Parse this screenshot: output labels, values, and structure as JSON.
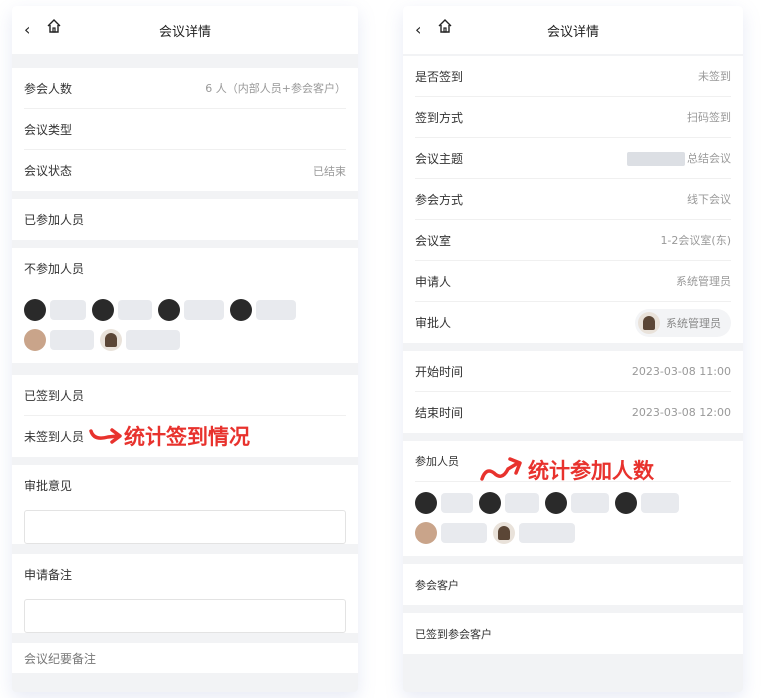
{
  "left": {
    "nav": {
      "title": "会议详情"
    },
    "info_rows": [
      {
        "label": "参会人数",
        "value": "6 人（内部人员+参会客户）"
      },
      {
        "label": "会议类型",
        "value": ""
      },
      {
        "label": "会议状态",
        "value": "已结束"
      }
    ],
    "joined_label": "已参加人员",
    "not_joined_label": "不参加人员",
    "signed_label": "已签到人员",
    "unsigned_label": "未签到人员",
    "review_label": "审批意见",
    "remark_label": "申请备注",
    "bottom_cut_label": "会议纪要备注",
    "annotation": "统计签到情况"
  },
  "right": {
    "nav": {
      "title": "会议详情"
    },
    "rows_a": [
      {
        "label": "是否签到",
        "value": "未签到"
      },
      {
        "label": "签到方式",
        "value": "扫码签到"
      },
      {
        "label": "会议主题",
        "value": "总结会议"
      },
      {
        "label": "参会方式",
        "value": "线下会议"
      },
      {
        "label": "会议室",
        "value": "1-2会议室(东)"
      },
      {
        "label": "申请人",
        "value": "系统管理员"
      }
    ],
    "approver": {
      "label": "审批人",
      "name": "系统管理员"
    },
    "times": [
      {
        "label": "开始时间",
        "value": "2023-03-08 11:00"
      },
      {
        "label": "结束时间",
        "value": "2023-03-08 12:00"
      }
    ],
    "participants_label": "参加人员",
    "clients_label": "参会客户",
    "signed_clients_label": "已签到参会客户",
    "annotation": "统计参加人数"
  },
  "colors": {
    "annotation": "#e8322d",
    "bg": "#f2f3f5"
  }
}
